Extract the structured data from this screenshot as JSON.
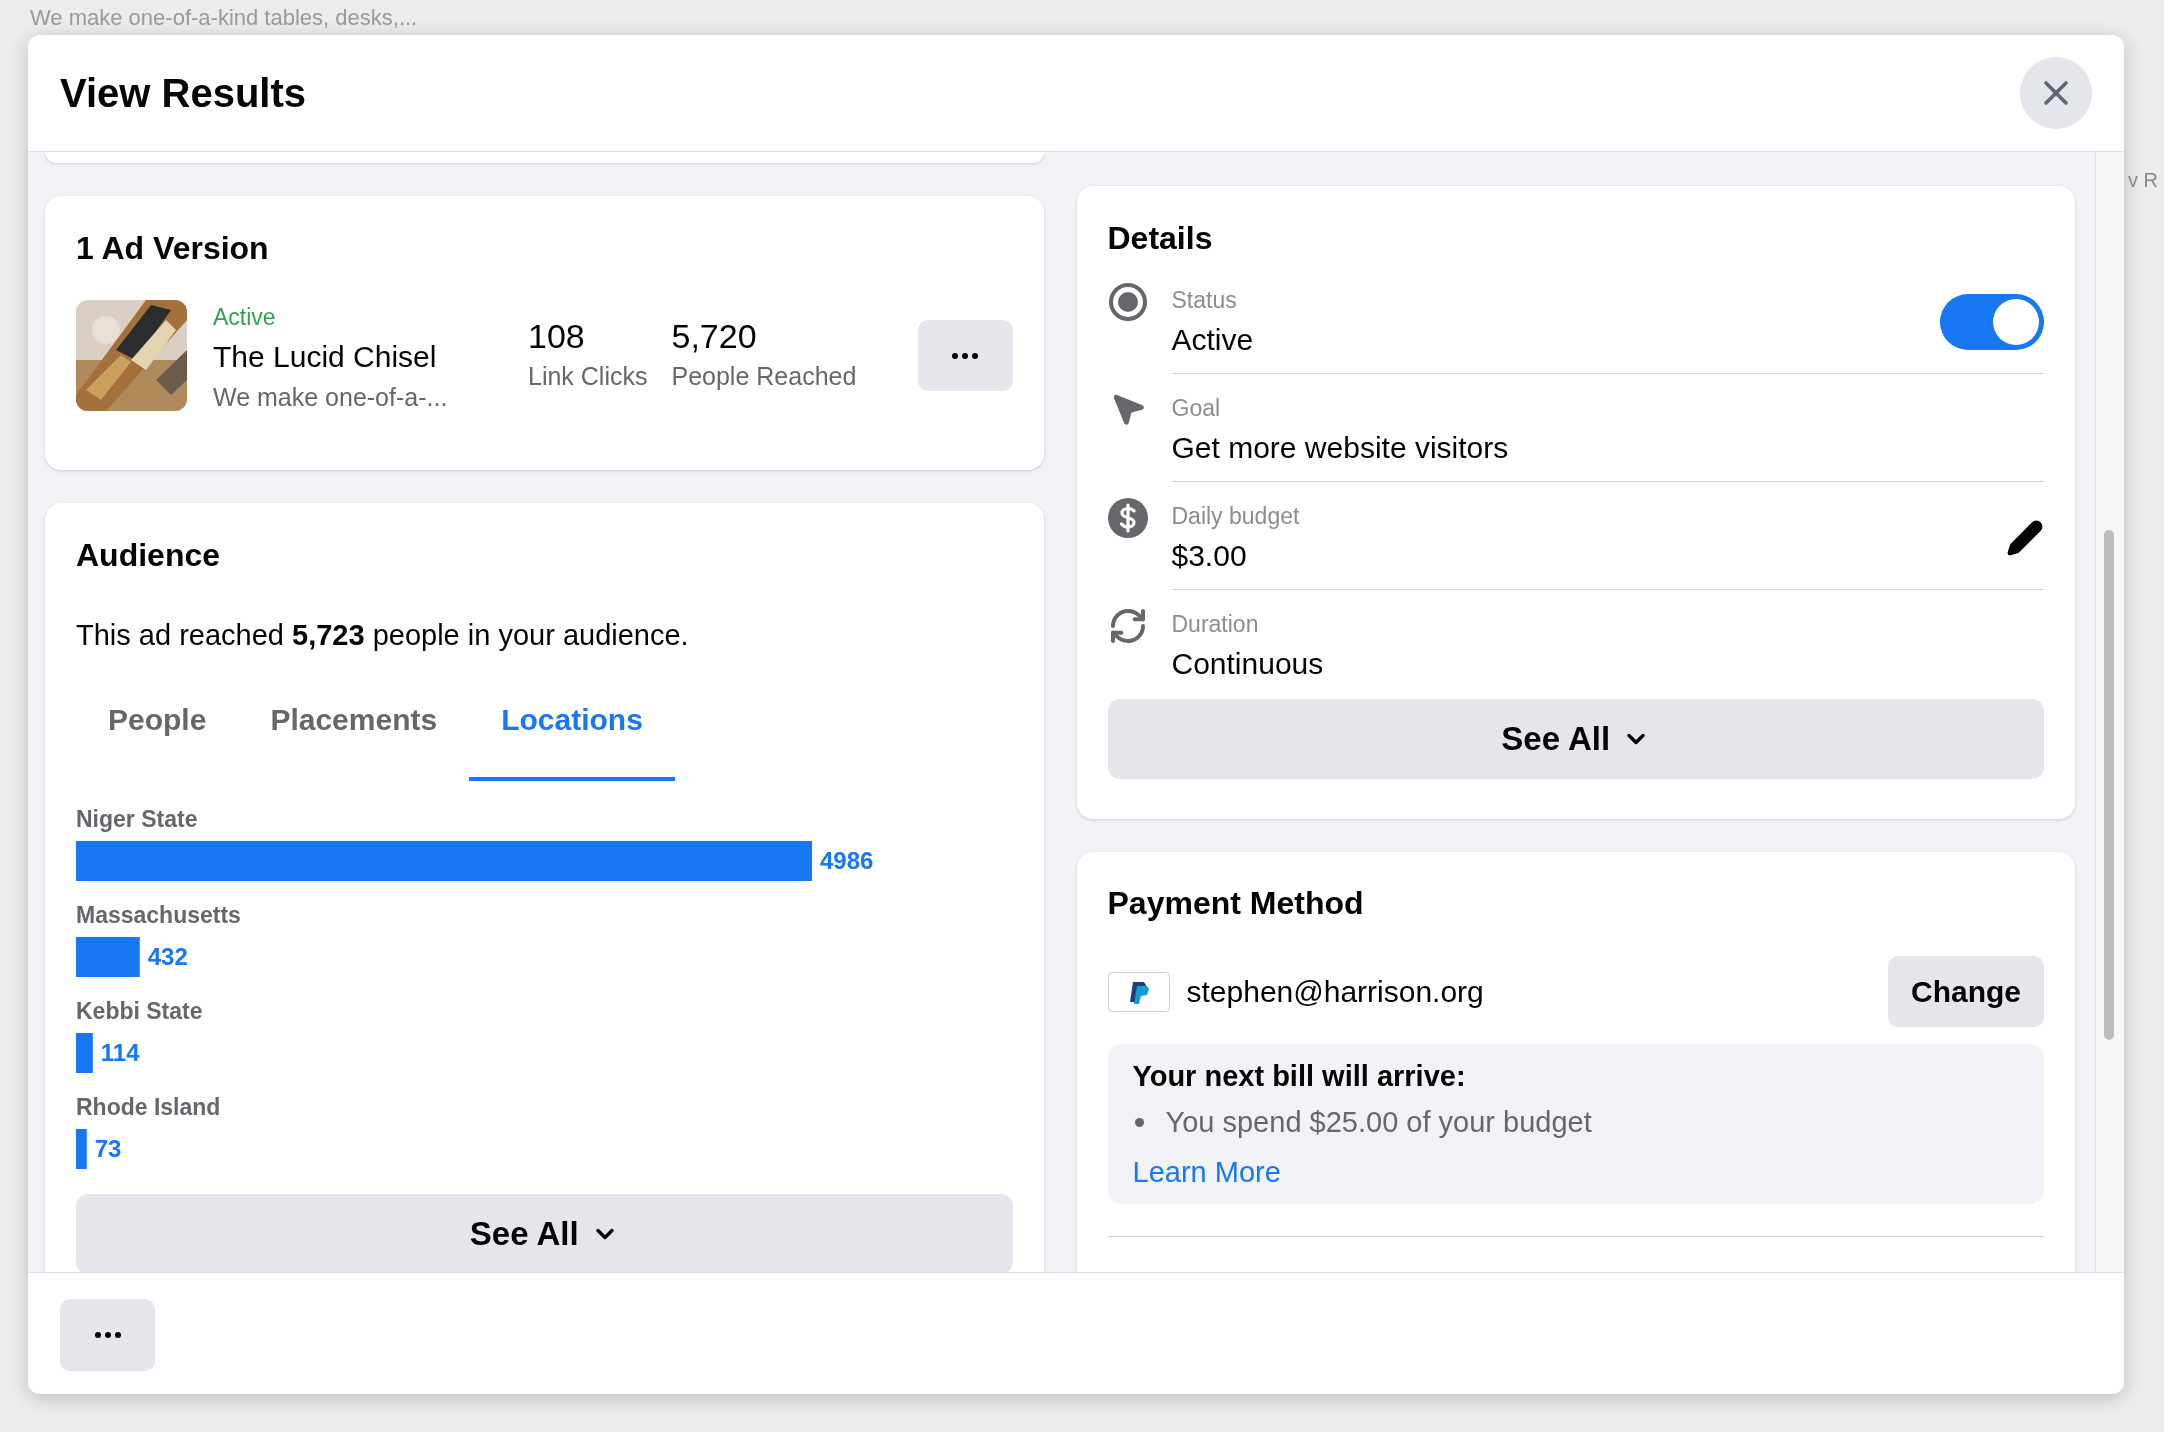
{
  "background_page": {
    "text": "We make one-of-a-kind tables, desks,...",
    "edge_text": "v R"
  },
  "dialog": {
    "title": "View Results"
  },
  "ad_version": {
    "title": "1 Ad Version",
    "ad": {
      "status": "Active",
      "name": "The Lucid Chisel",
      "description": "We make one-of-a-...",
      "stats": [
        {
          "value": "108",
          "label": "Link Clicks"
        },
        {
          "value": "5,720",
          "label": "People Reached"
        }
      ]
    }
  },
  "audience": {
    "title": "Audience",
    "summary": "This ad reached **5,723** people in your audience.",
    "tabs": [
      {
        "label": "People",
        "selected": false
      },
      {
        "label": "Placements",
        "selected": false
      },
      {
        "label": "Locations",
        "selected": true
      }
    ],
    "chart_data": {
      "type": "bar",
      "orientation": "horizontal",
      "categories": [
        "Niger State",
        "Massachusetts",
        "Kebbi State",
        "Rhode Island"
      ],
      "values": [
        4986,
        432,
        114,
        73
      ],
      "data_labels": true
    },
    "see_all": "See All"
  },
  "details": {
    "title": "Details",
    "rows": [
      {
        "kind": "status",
        "label": "Status",
        "value": "Active",
        "on": true
      },
      {
        "kind": "goal",
        "label": "Goal",
        "value": "Get more website visitors"
      },
      {
        "kind": "budget",
        "label": "Daily budget",
        "value": "$3.00"
      },
      {
        "kind": "duration",
        "label": "Duration",
        "value": "Continuous"
      }
    ],
    "see_all": "See All"
  },
  "payment": {
    "title": "Payment Method",
    "account": "stephen@harrison.org",
    "change": "Change",
    "bill": {
      "title": "Your next bill will arrive:",
      "items": [
        "You spend $25.00 of your budget"
      ],
      "link": "Learn More"
    }
  }
}
